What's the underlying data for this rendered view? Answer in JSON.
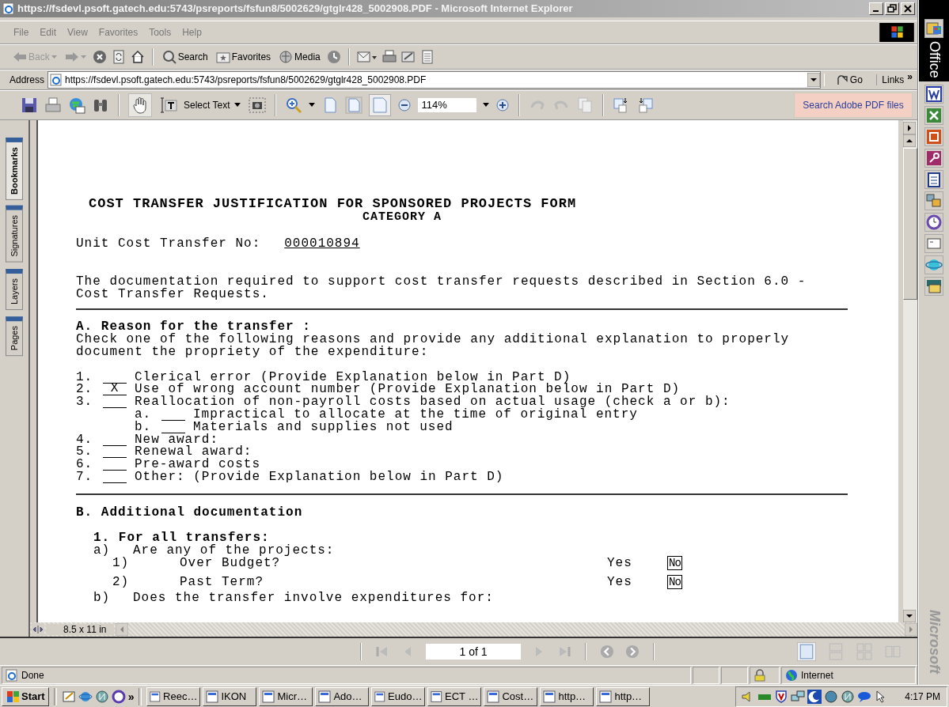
{
  "window": {
    "title": "https://fsdevl.psoft.gatech.edu:5743/psreports/fsfun8/5002629/gtglr428_5002908.PDF - Microsoft Internet Explorer"
  },
  "menu": [
    "File",
    "Edit",
    "View",
    "Favorites",
    "Tools",
    "Help"
  ],
  "toolbar": {
    "back": "Back",
    "search": "Search",
    "favorites": "Favorites",
    "media": "Media"
  },
  "address": {
    "label": "Address",
    "value": "https://fsdevl.psoft.gatech.edu:5743/psreports/fsfun8/5002629/gtglr428_5002908.PDF",
    "go": "Go",
    "links": "Links",
    "links_more": "»"
  },
  "pdf_toolbar": {
    "select_text": "Select Text",
    "zoom": "114%",
    "search_button": "Search Adobe PDF files"
  },
  "side_tabs": [
    {
      "label": "Bookmarks",
      "selected": true
    },
    {
      "label": "Signatures",
      "selected": false
    },
    {
      "label": "Layers",
      "selected": false
    },
    {
      "label": "Pages",
      "selected": false
    }
  ],
  "document": {
    "title": "COST TRANSFER JUSTIFICATION FOR SPONSORED PROJECTS FORM",
    "subtitle": "CATEGORY A",
    "transfer_no": {
      "label": "Unit Cost Transfer No:",
      "value": "000010894"
    },
    "intro": "The documentation required to support cost transfer requests described in Section 6.0 -\nCost Transfer Requests.",
    "section_a": {
      "heading": "A. Reason for the transfer :",
      "instructions": "Check one of the following reasons and provide any additional explanation to properly\ndocument the propriety of the expenditure:",
      "reasons": [
        {
          "number": "1.",
          "text": "Clerical error (Provide Explanation below in Part D)"
        },
        {
          "number": "2.",
          "answer": "X",
          "text": "Use of wrong account number (Provide Explanation below in Part D)"
        },
        {
          "number": "3.",
          "text": "Reallocation of non-payroll costs based on actual usage (check a or b):",
          "children": [
            {
              "number": "a.",
              "text": "Impractical to allocate at the time of original entry"
            },
            {
              "number": "b.",
              "text": "Materials and supplies not used"
            }
          ]
        },
        {
          "number": "4.",
          "text": "New award:"
        },
        {
          "number": "5.",
          "text": "Renewal award:"
        },
        {
          "number": "6.",
          "text": "Pre-award costs"
        },
        {
          "number": "7.",
          "text": "Other: (Provide Explanation below in Part D)"
        }
      ]
    },
    "section_b": {
      "heading": "B. Additional documentation",
      "subheading": "1. For all transfers:",
      "question": {
        "label": "a)",
        "text": "Are any of the projects:"
      },
      "items": [
        {
          "number": "1)",
          "text": "Over Budget?",
          "options": [
            {
              "label": "Yes",
              "selected": false
            },
            {
              "label": "No",
              "selected": true
            }
          ]
        },
        {
          "number": "2)",
          "text": "Past Term?",
          "options": [
            {
              "label": "Yes",
              "selected": false
            },
            {
              "label": "No",
              "selected": true
            }
          ]
        }
      ],
      "next_question": {
        "label": "b)",
        "text": "Does the transfer involve expenditures for:"
      }
    }
  },
  "page_size": "8.5 x 11 in",
  "page_indicator": "1 of 1",
  "status": {
    "text": "Done",
    "zone": "Internet"
  },
  "office_bar": {
    "title": "Office",
    "footer": "Microsoft"
  },
  "taskbar": {
    "start": "Start",
    "quick_more": "»",
    "buttons": [
      "Reec…",
      "IKON",
      "Micr…",
      "Ado…",
      "Eudo…",
      "ECT …",
      "Cost…",
      "http…",
      "http…"
    ],
    "clock": "4:17 PM"
  }
}
